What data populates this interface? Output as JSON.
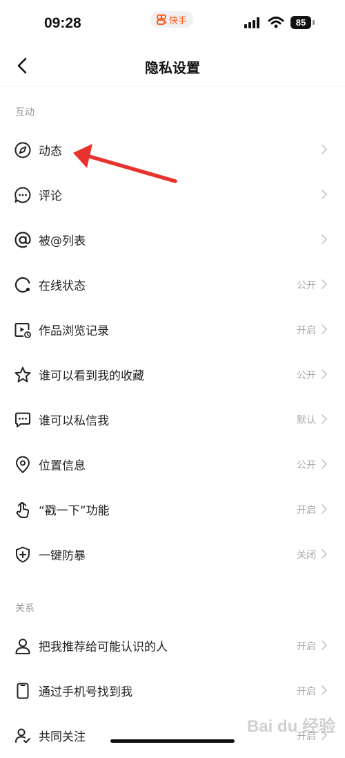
{
  "status_bar": {
    "time": "09:28",
    "app_name": "快手",
    "battery": "85"
  },
  "nav": {
    "title": "隐私设置"
  },
  "sections": [
    {
      "label": "互动"
    },
    {
      "label": "关系"
    }
  ],
  "items": [
    {
      "label": "动态",
      "value": "",
      "icon": "compass-icon"
    },
    {
      "label": "评论",
      "value": "",
      "icon": "comment-icon"
    },
    {
      "label": "被@列表",
      "value": "",
      "icon": "at-icon"
    },
    {
      "label": "在线状态",
      "value": "公开",
      "icon": "online-status-icon"
    },
    {
      "label": "作品浏览记录",
      "value": "开启",
      "icon": "video-history-icon"
    },
    {
      "label": "谁可以看到我的收藏",
      "value": "公开",
      "icon": "star-icon"
    },
    {
      "label": "谁可以私信我",
      "value": "默认",
      "icon": "message-icon"
    },
    {
      "label": "位置信息",
      "value": "公开",
      "icon": "location-icon"
    },
    {
      "label": "“戳一下”功能",
      "value": "开启",
      "icon": "poke-hand-icon"
    },
    {
      "label": "一键防暴",
      "value": "关闭",
      "icon": "shield-plus-icon"
    },
    {
      "label": "把我推荐给可能认识的人",
      "value": "开启",
      "icon": "person-icon"
    },
    {
      "label": "通过手机号找到我",
      "value": "开启",
      "icon": "phone-icon"
    },
    {
      "label": "共同关注",
      "value": "开启",
      "icon": "mutual-follow-icon"
    }
  ],
  "watermark": "Bai du 经验",
  "colors": {
    "accent": "#ff5a1f",
    "annotation_arrow": "#e8322d",
    "secondary_text": "#a8a8a8"
  }
}
